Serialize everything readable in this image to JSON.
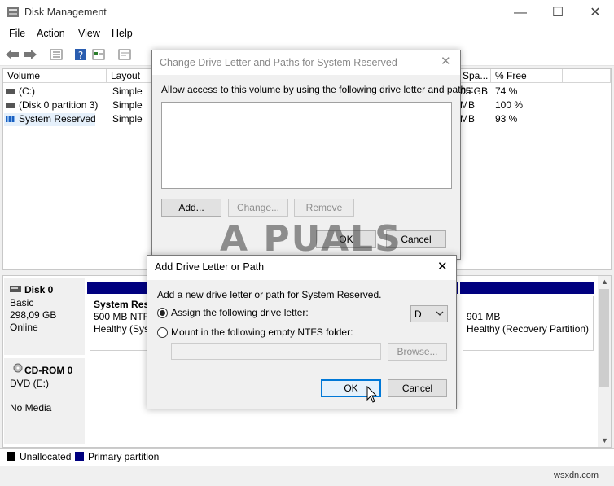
{
  "window": {
    "title": "Disk Management",
    "minimize": "—",
    "maximize": "☐",
    "close": "✕"
  },
  "menu": [
    "File",
    "Action",
    "View",
    "Help"
  ],
  "toolbar_icons": [
    "back-arrow-icon",
    "forward-arrow-icon",
    "list-view-icon",
    "help-icon",
    "properties-icon",
    "console-icon"
  ],
  "volume_table": {
    "columns": [
      "Volume",
      "Layout",
      "Spa...",
      "% Free"
    ],
    "rows": [
      {
        "volume": "(C:)",
        "layout": "Simple",
        "space": "05 GB",
        "free": "74 %"
      },
      {
        "volume": "(Disk 0 partition 3)",
        "layout": "Simple",
        "space": "MB",
        "free": "100 %"
      },
      {
        "volume": "System Reserved",
        "layout": "Simple",
        "space": "MB",
        "free": "93 %"
      }
    ]
  },
  "disks": [
    {
      "name": "Disk 0",
      "type": "Basic",
      "size": "298,09 GB",
      "status": "Online",
      "partitions": [
        {
          "name": "System Rese",
          "line2": "500 MB NTFS",
          "line3": "Healthy (Syst"
        },
        {
          "name": "",
          "line2": "901 MB",
          "line3": "Healthy (Recovery Partition)"
        }
      ]
    },
    {
      "name": "CD-ROM 0",
      "type": "DVD (E:)",
      "size": "",
      "status": "No Media"
    }
  ],
  "legend": {
    "unallocated": "Unallocated",
    "primary": "Primary partition",
    "colors": {
      "unallocated": "#000000",
      "primary": "#00007f"
    }
  },
  "change_dialog": {
    "title": "Change Drive Letter and Paths for System Reserved",
    "instruction": "Allow access to this volume by using the following drive letter and paths:",
    "add": "Add...",
    "change": "Change...",
    "remove": "Remove",
    "ok": "OK",
    "cancel": "Cancel"
  },
  "add_dialog": {
    "title": "Add Drive Letter or Path",
    "instruction": "Add a new drive letter or path for System Reserved.",
    "assign_label": "Assign the following drive letter:",
    "drive_letter": "D",
    "mount_label": "Mount in the following empty NTFS folder:",
    "browse": "Browse...",
    "ok": "OK",
    "cancel": "Cancel"
  },
  "watermark": "A PUALS",
  "site": "wsxdn.com"
}
